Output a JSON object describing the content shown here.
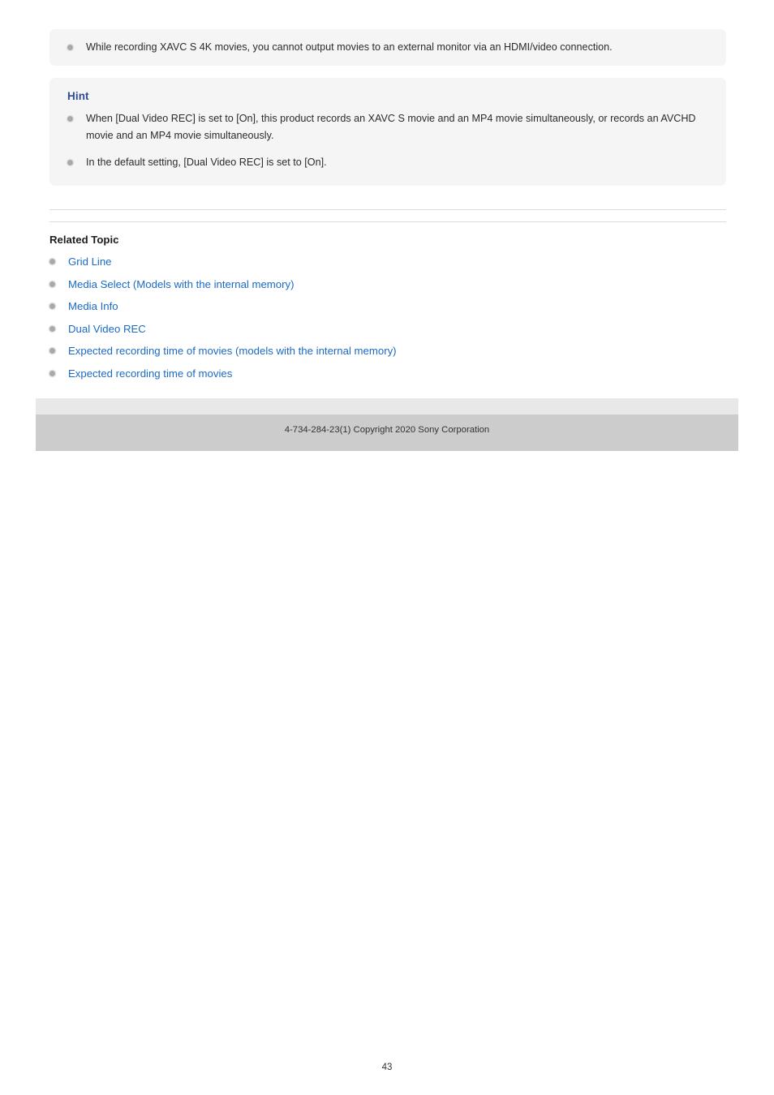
{
  "document": {
    "page_number": "43"
  },
  "notice_box": {
    "items": [
      "While recording XAVC S 4K movies, you cannot output movies to an external monitor via an HDMI/video connection."
    ]
  },
  "hint_box": {
    "title": "Hint",
    "items": [
      "When [Dual Video REC] is set to [On], this product records an XAVC S movie and an MP4 movie simultaneously, or records an AVCHD movie and an MP4 movie simultaneously.",
      "In the default setting, [Dual Video REC] is set to [On]."
    ]
  },
  "related_topic": {
    "heading": "Related Topic",
    "links": [
      "Grid Line",
      "Media Select (Models with the internal memory)",
      "Media Info",
      "Dual Video REC",
      "Expected recording time of movies (models with the internal memory)",
      "Expected recording time of movies"
    ]
  },
  "footer": {
    "copyright": "4-734-284-23(1) Copyright 2020 Sony Corporation"
  },
  "colors": {
    "hint_title": "#2e4b8f",
    "link": "#1b6ac4",
    "box_background": "#f5f5f5",
    "footer_light": "#e8e8e8",
    "footer_dark": "#cccccc",
    "bullet": "#a9a9a9"
  }
}
